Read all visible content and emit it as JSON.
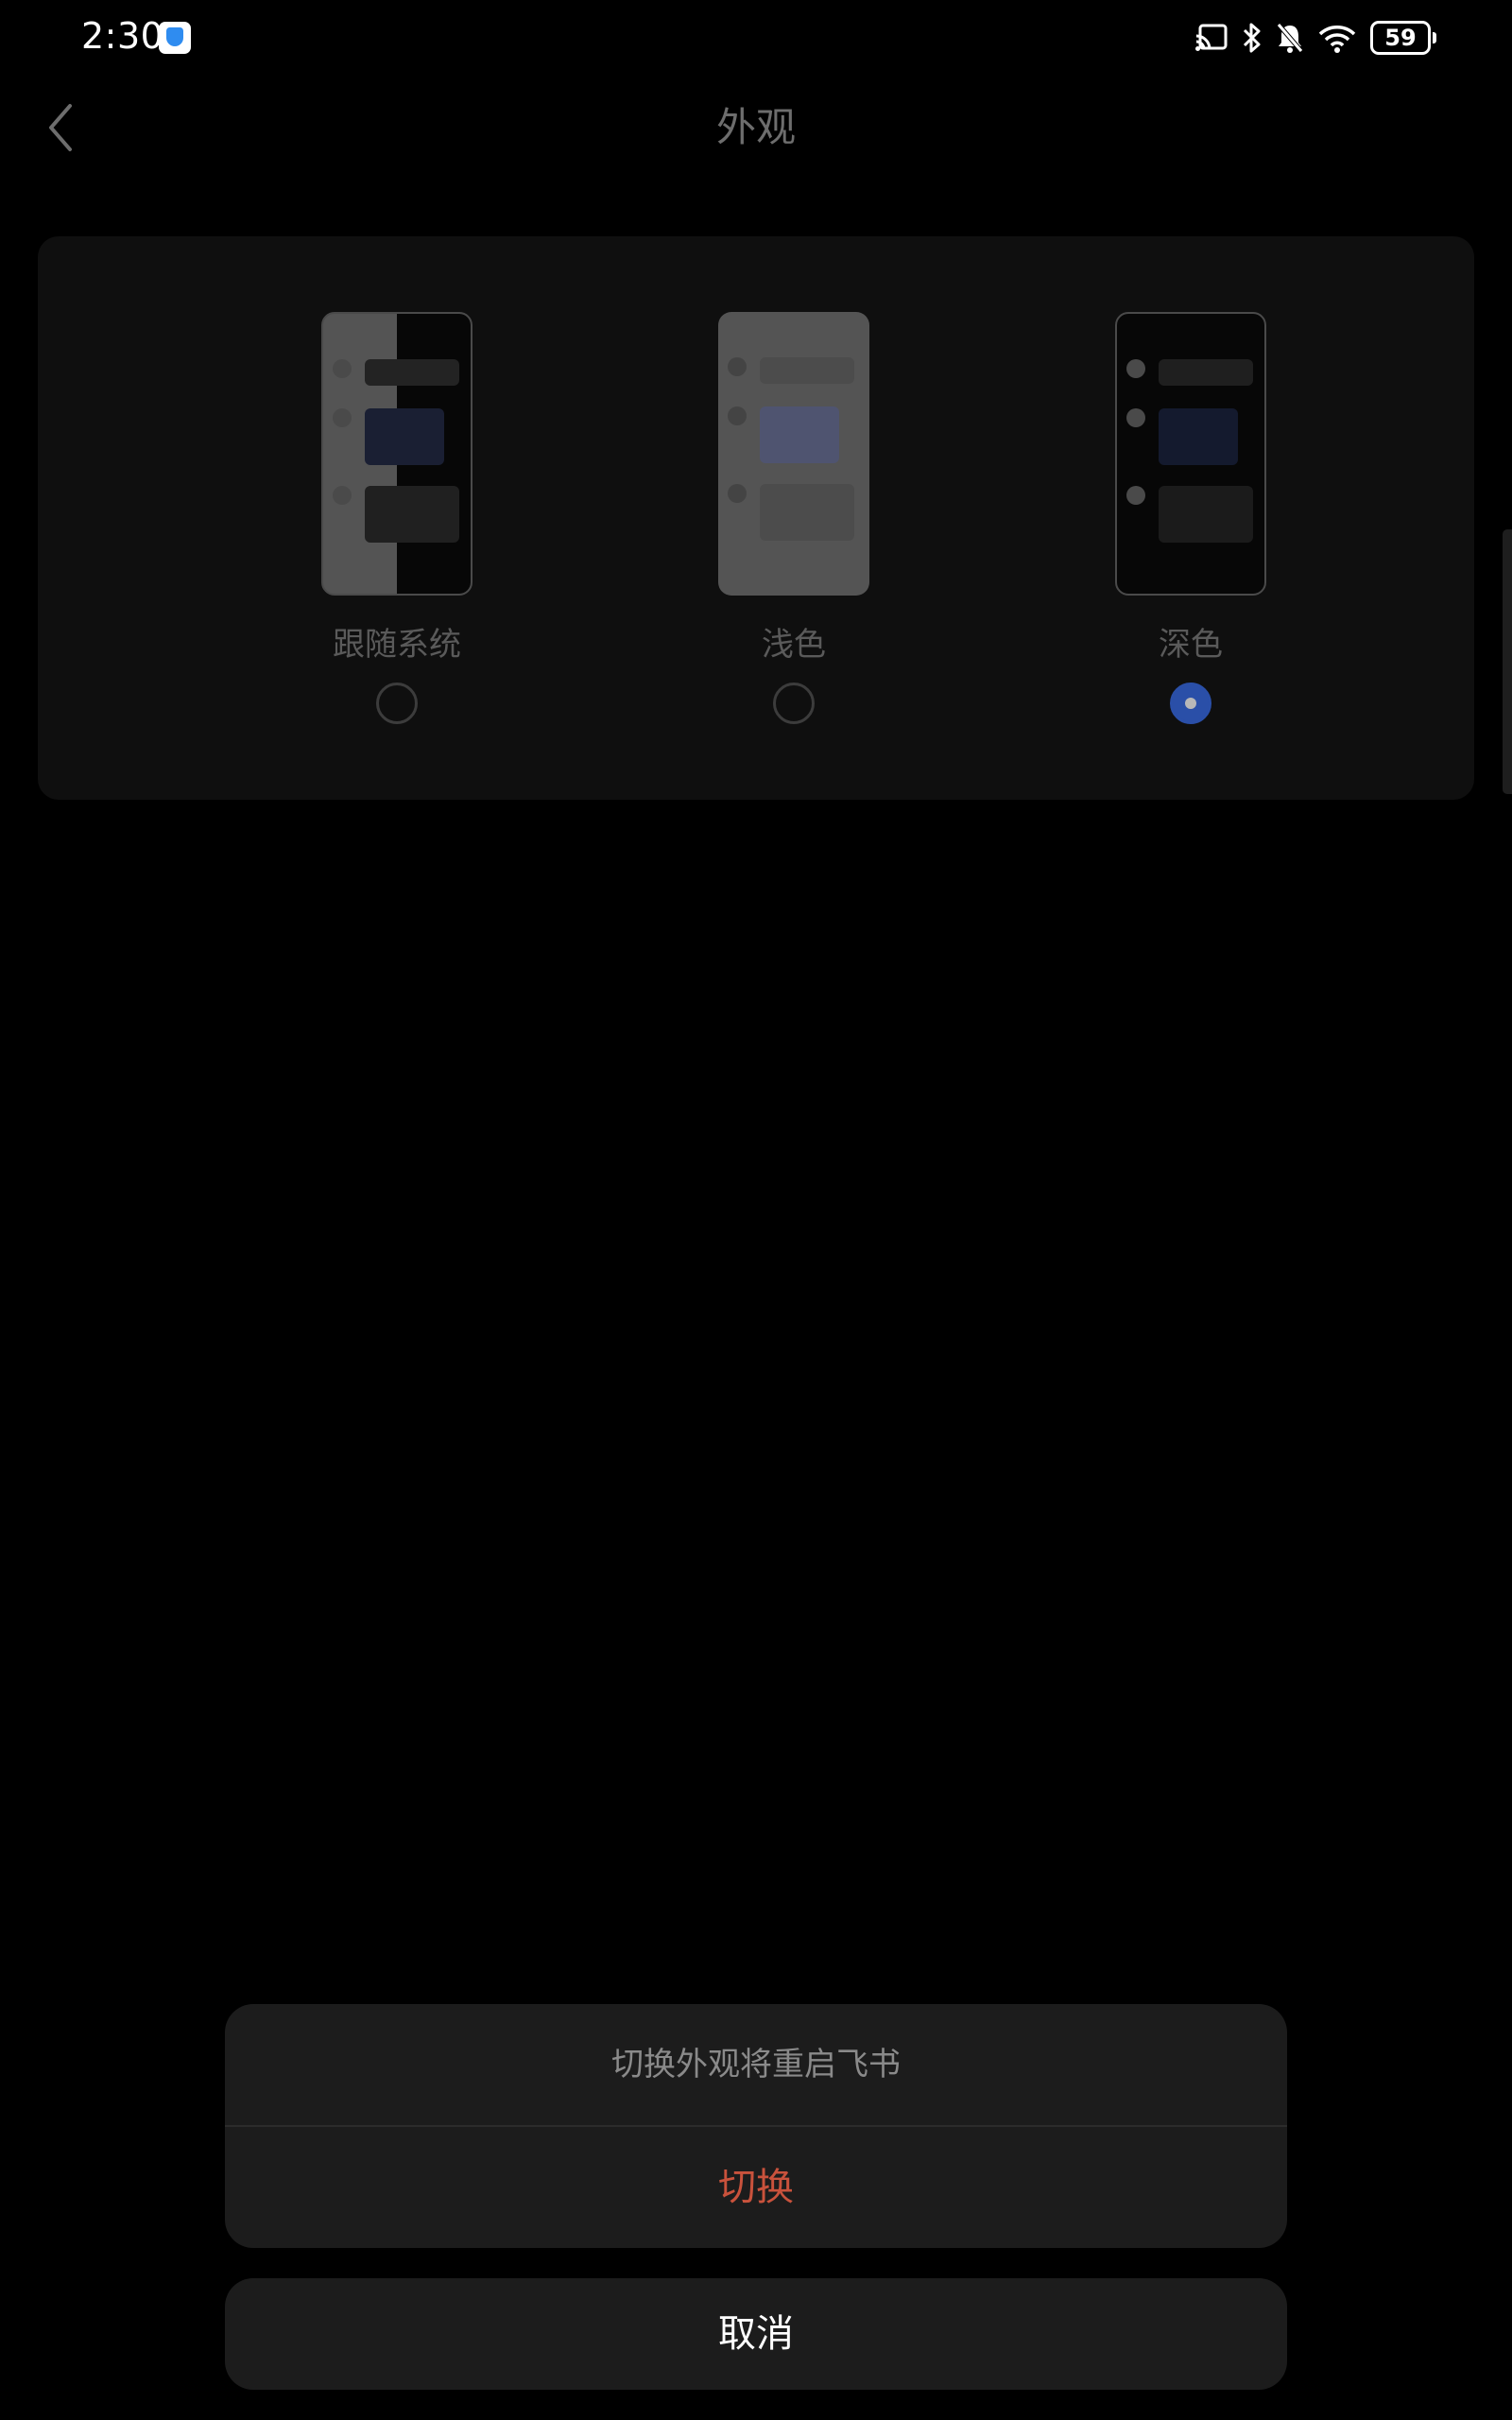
{
  "status_bar": {
    "time": "2:30",
    "battery": "59",
    "icons": [
      "shield-app-icon",
      "screen-cast-icon",
      "bluetooth-icon",
      "bell-off-icon",
      "wifi-icon",
      "battery-icon"
    ]
  },
  "header": {
    "title": "外观",
    "back_icon": "chevron-left-icon"
  },
  "appearance": {
    "options": [
      {
        "label": "跟随系统",
        "selected": false
      },
      {
        "label": "浅色",
        "selected": false
      },
      {
        "label": "深色",
        "selected": true
      }
    ]
  },
  "dialog": {
    "message": "切换外观将重启飞书",
    "confirm_label": "切换",
    "cancel_label": "取消"
  },
  "colors": {
    "background": "#000000",
    "confirm": "#c9523c",
    "radio_selected": "#2a4fa8"
  }
}
